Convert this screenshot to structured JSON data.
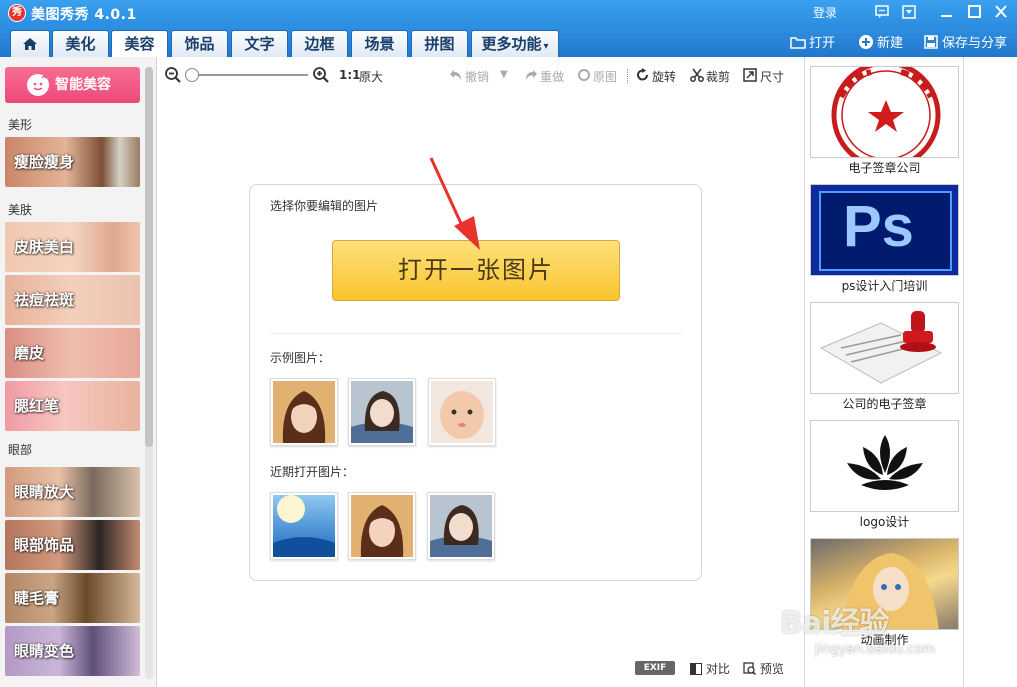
{
  "window": {
    "app_logo_char": "秀",
    "title": "美图秀秀 4.0.1",
    "login": "登录"
  },
  "tabs": [
    {
      "label": "美化"
    },
    {
      "label": "美容",
      "active": true
    },
    {
      "label": "饰品"
    },
    {
      "label": "文字"
    },
    {
      "label": "边框"
    },
    {
      "label": "场景"
    },
    {
      "label": "拼图"
    },
    {
      "label": "更多功能"
    }
  ],
  "top_actions": {
    "open": "打开",
    "new": "新建",
    "save_share": "保存与分享"
  },
  "left_panel": {
    "smart_beauty": "智能美容",
    "categories": [
      {
        "label": "美形"
      },
      {
        "label": "美肤"
      },
      {
        "label": "眼部"
      }
    ],
    "features": [
      {
        "label": "瘦脸瘦身"
      },
      {
        "label": "皮肤美白"
      },
      {
        "label": "祛痘祛斑"
      },
      {
        "label": "磨皮"
      },
      {
        "label": "腮红笔"
      },
      {
        "label": "眼睛放大"
      },
      {
        "label": "眼部饰品"
      },
      {
        "label": "睫毛膏"
      },
      {
        "label": "眼睛变色"
      }
    ]
  },
  "toolbar": {
    "zoom_ratio": "1:1",
    "original_size": "原大",
    "undo": "撤销",
    "redo": "重做",
    "original": "原图",
    "rotate": "旋转",
    "crop": "裁剪",
    "size": "尺寸"
  },
  "card": {
    "prompt": "选择你要编辑的图片",
    "open_button": "打开一张图片",
    "examples_label": "示例图片：",
    "recent_label": "近期打开图片："
  },
  "ads": [
    {
      "caption": "电子签章公司"
    },
    {
      "caption": "ps设计入门培训",
      "logo_text": "Ps"
    },
    {
      "caption": "公司的电子签章"
    },
    {
      "caption": "logo设计"
    },
    {
      "caption": "动画制作"
    }
  ],
  "bottom": {
    "exif": "EXIF",
    "compare": "对比",
    "preview": "预览"
  },
  "watermark": {
    "brand": "Bai经验",
    "url": "jingyan.baidu.com"
  },
  "colors": {
    "title_bar": "#2d8ee0",
    "smart_button": "#ec4a78",
    "open_button": "#f9c52e",
    "arrow": "#e8322e"
  }
}
